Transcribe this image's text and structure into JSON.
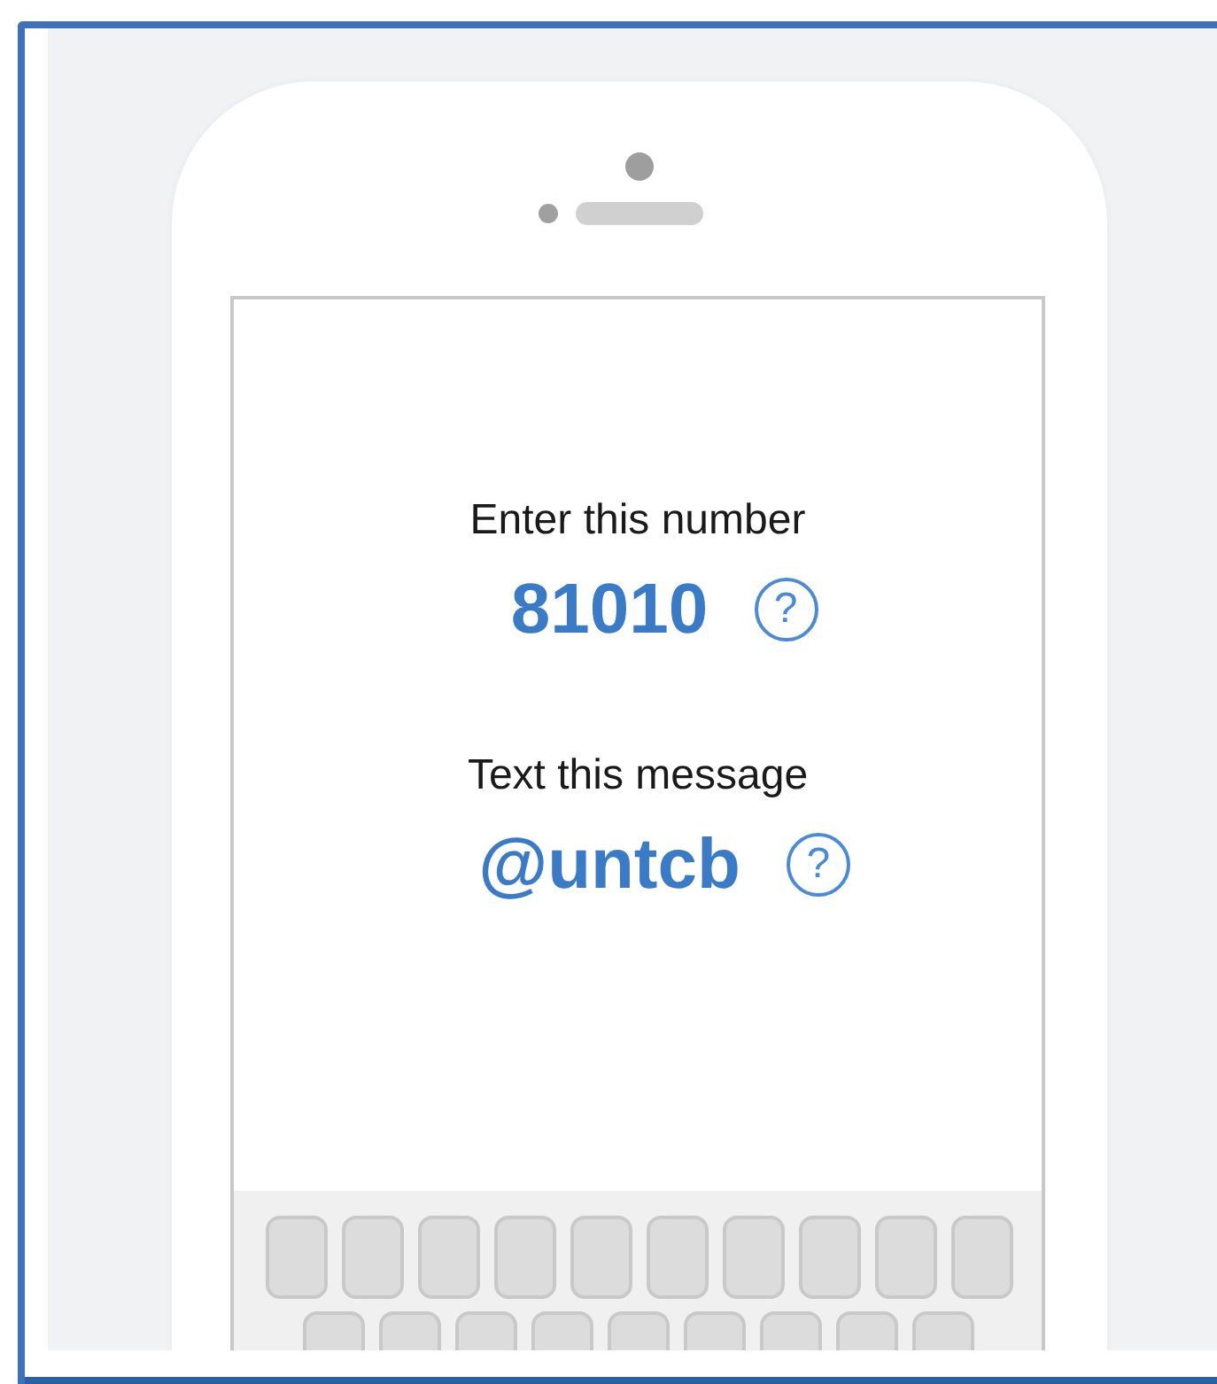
{
  "prompts": [
    {
      "label": "Enter this number",
      "value": "81010",
      "help_icon": "?"
    },
    {
      "label": "Text this message",
      "value": "@untcb",
      "help_icon": "?"
    }
  ]
}
